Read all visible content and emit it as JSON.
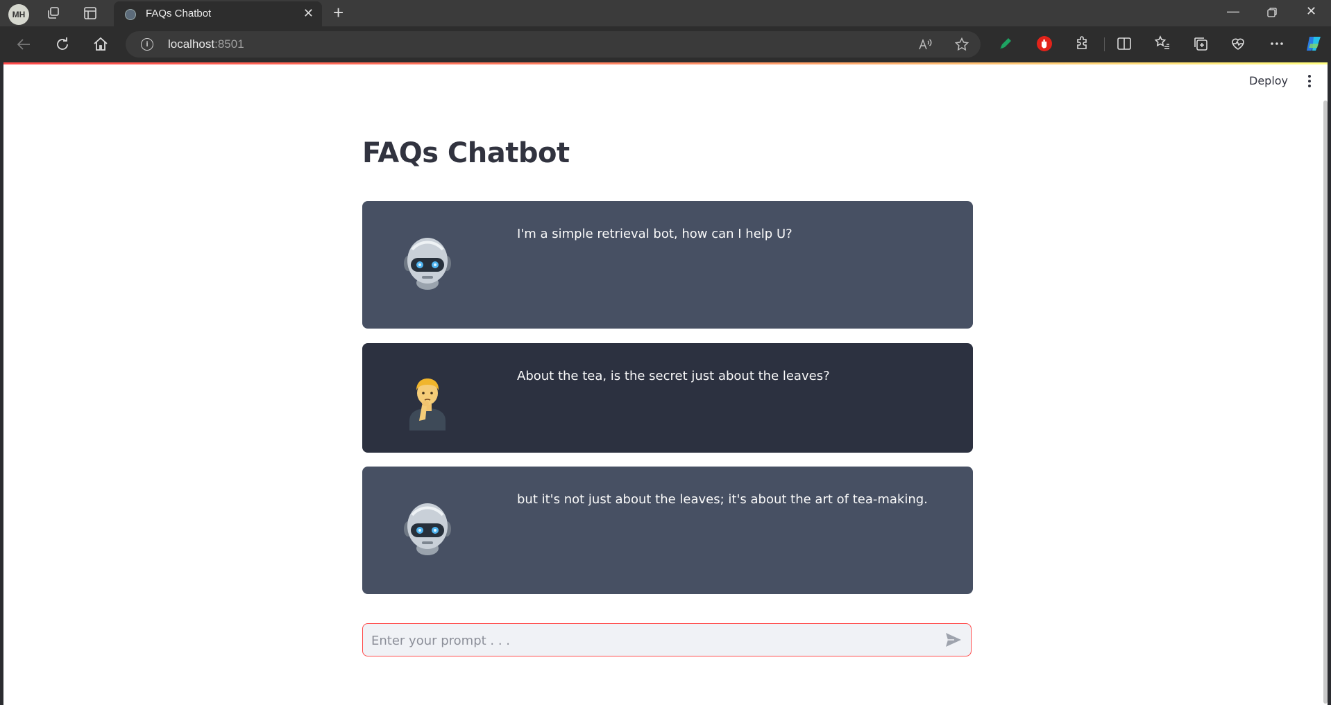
{
  "browser": {
    "profile_initials": "MH",
    "tab_title": "FAQs Chatbot",
    "url_host": "localhost",
    "url_port": ":8501"
  },
  "app": {
    "deploy_label": "Deploy",
    "title": "FAQs Chatbot",
    "messages": [
      {
        "role": "assistant",
        "avatar": "robot-icon",
        "text": "I'm a simple retrieval bot, how can I help U?"
      },
      {
        "role": "user",
        "avatar": "thinking-person-icon",
        "text": "About the tea, is the secret just about the leaves?"
      },
      {
        "role": "assistant",
        "avatar": "robot-icon",
        "text": "but it's not just about the leaves; it's about the art of tea-making."
      }
    ],
    "input_placeholder": "Enter your prompt . . ."
  },
  "colors": {
    "accent": "#ff4b4b",
    "bot_bubble": "#475063",
    "user_bubble": "#2c3140",
    "title": "#31333f"
  }
}
